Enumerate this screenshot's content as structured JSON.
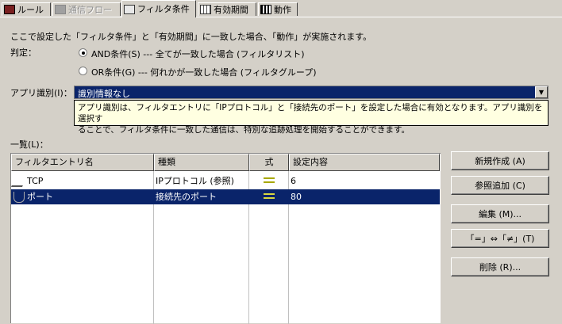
{
  "tabs": [
    {
      "label": "ルール",
      "icon": "rule-icon",
      "state": "normal"
    },
    {
      "label": "通信フロー",
      "icon": "flow-icon",
      "state": "disabled"
    },
    {
      "label": "フィルタ条件",
      "icon": "filter-icon",
      "state": "active"
    },
    {
      "label": "有効期間",
      "icon": "calendar-icon",
      "state": "normal"
    },
    {
      "label": "動作",
      "icon": "action-icon",
      "state": "normal"
    }
  ],
  "description": "ここで設定した「フィルタ条件」と「有効期間」に一致した場合、「動作」が実施されます。",
  "judge": {
    "label": "判定：",
    "options": [
      {
        "label": "AND条件(S) --- 全てが一致した場合 (フィルタリスト)",
        "selected": true
      },
      {
        "label": "OR条件(G) --- 何れかが一致した場合 (フィルタグループ)",
        "selected": false
      }
    ]
  },
  "app_id": {
    "label": "アプリ識別(I)：",
    "value": "識別情報なし",
    "tooltip_line1": "アプリ識別は、フィルタエントリに「IPプロトコル」と「接続先のポート」を設定した場合に有効となります。アプリ識別を選択す",
    "tooltip_line2": "ることで、フィルタ条件に一致した通信は、特別な追跡処理を開始することができます。"
  },
  "list": {
    "label": "一覧(L)：",
    "columns": [
      "フィルタエントリ名",
      "種類",
      "式",
      "設定内容"
    ],
    "rows": [
      {
        "name": "TCP",
        "type": "IPプロトコル (参照)",
        "op": "=",
        "value": "6",
        "selected": false
      },
      {
        "name": "ポート",
        "type": "接続先のポート",
        "op": "=",
        "value": "80",
        "selected": true
      }
    ]
  },
  "buttons": {
    "new": "新規作成 (A)",
    "ref_add": "参照追加 (C)",
    "edit": "編集 (M)...",
    "toggle": "「=」⇔「≠」(T)",
    "delete": "削除 (R)..."
  },
  "colors": {
    "selection": "#0a246a",
    "op_mark": "#c8c800",
    "tooltip_bg": "#ffffe1"
  }
}
